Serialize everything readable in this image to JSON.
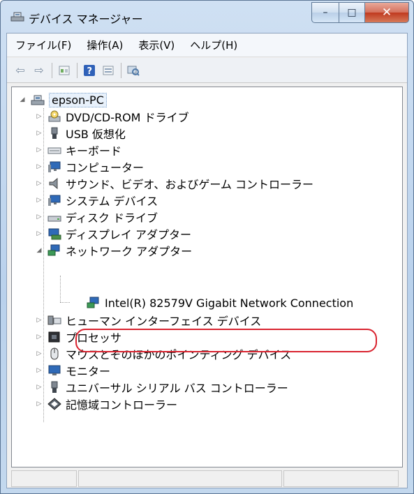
{
  "window": {
    "title": "デバイス マネージャー"
  },
  "menubar": {
    "items": [
      "ファイル(F)",
      "操作(A)",
      "表示(V)",
      "ヘルプ(H)"
    ]
  },
  "toolbar": {
    "buttons": [
      "back-arrow-icon",
      "forward-arrow-icon",
      "properties-icon",
      "help-icon",
      "view-icon",
      "scan-hardware-icon"
    ]
  },
  "tree": {
    "root": "epson-PC",
    "categories": [
      "DVD/CD-ROM ドライブ",
      "USB 仮想化",
      "キーボード",
      "コンピューター",
      "サウンド、ビデオ、およびゲーム コントローラー",
      "システム デバイス",
      "ディスク ドライブ",
      "ディスプレイ アダプター",
      "ネットワーク アダプター",
      "ヒューマン インターフェイス デバイス",
      "プロセッサ",
      "マウスとそのほかのポインティング デバイス",
      "モニター",
      "ユニバーサル シリアル バス コントローラー",
      "記憶域コントローラー"
    ],
    "network_child": "Intel(R) 82579V Gigabit Network Connection"
  },
  "colors": {
    "highlight": "#d9222e",
    "title_bg": "#cfe0f3"
  }
}
